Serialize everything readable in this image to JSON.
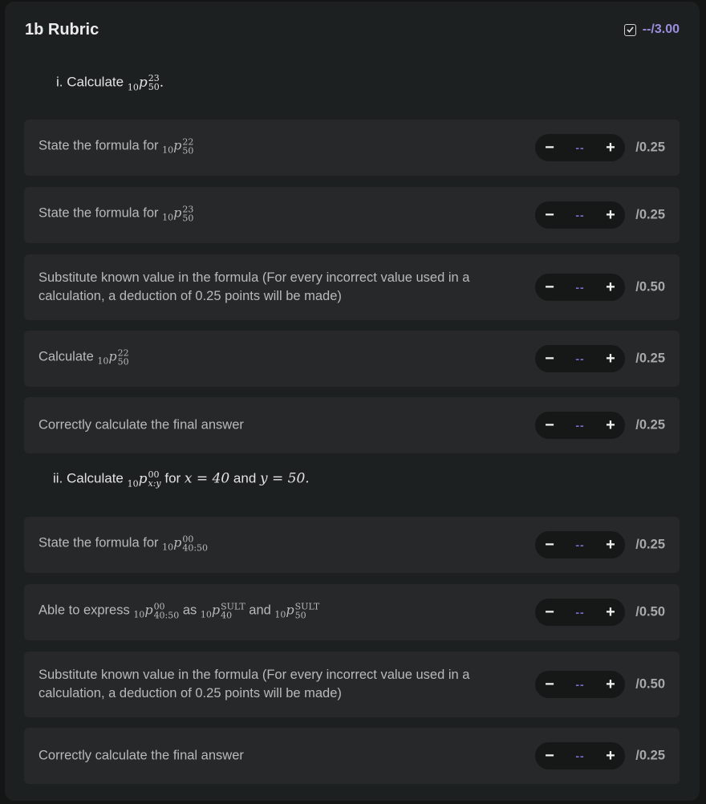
{
  "header": {
    "title": "1b Rubric",
    "score_dash": "--",
    "score_max": "/3.00",
    "status_icon": "checkbox-checked-icon"
  },
  "sections": [
    {
      "prefix": "i. Calculate ",
      "math": {
        "pre": "10",
        "base": "p",
        "sup": "23",
        "sub": "50",
        "after": "."
      },
      "text_after": ""
    },
    {
      "prefix": "ii. Calculate ",
      "math": {
        "pre": "10",
        "base": "p",
        "sup": "00",
        "sub": "x:y",
        "after": ""
      },
      "text_after": " for ",
      "cond": {
        "x": "x = 40",
        "and": " and ",
        "y": "y = 50."
      }
    }
  ],
  "criteria": [
    {
      "text": "State the formula for ",
      "m1": {
        "pre": "10",
        "sup": "22",
        "sub": "50"
      },
      "score": "--",
      "max": "/0.25"
    },
    {
      "text": "State the formula for ",
      "m1": {
        "pre": "10",
        "sup": "23",
        "sub": "50"
      },
      "score": "--",
      "max": "/0.25"
    },
    {
      "text": "Substitute known value in the formula (For every incorrect value used in a calculation, a deduction of 0.25 points will be made)",
      "score": "--",
      "max": "/0.50"
    },
    {
      "text": "Calculate ",
      "m1": {
        "pre": "10",
        "sup": "22",
        "sub": "50"
      },
      "score": "--",
      "max": "/0.25"
    },
    {
      "text": "Correctly calculate the final answer",
      "score": "--",
      "max": "/0.25"
    },
    {
      "text": "State the formula for ",
      "m1": {
        "pre": "10",
        "sup": "00",
        "sub": "40:50"
      },
      "score": "--",
      "max": "/0.25"
    },
    {
      "text": "Able to express ",
      "m1": {
        "pre": "10",
        "sup": "00",
        "sub": "40:50"
      },
      "mid": " as ",
      "m2": {
        "pre": "10",
        "sup": "SULT",
        "sub": "40"
      },
      "and": " and ",
      "m3": {
        "pre": "10",
        "sup": "SULT",
        "sub": "50"
      },
      "score": "--",
      "max": "/0.50"
    },
    {
      "text": "Substitute known value in the formula (For every incorrect value used in a calculation, a deduction of 0.25 points will be made)",
      "score": "--",
      "max": "/0.50"
    },
    {
      "text": "Correctly calculate the final answer",
      "score": "--",
      "max": "/0.25"
    }
  ],
  "stepper": {
    "minus": "−",
    "plus": "+"
  }
}
